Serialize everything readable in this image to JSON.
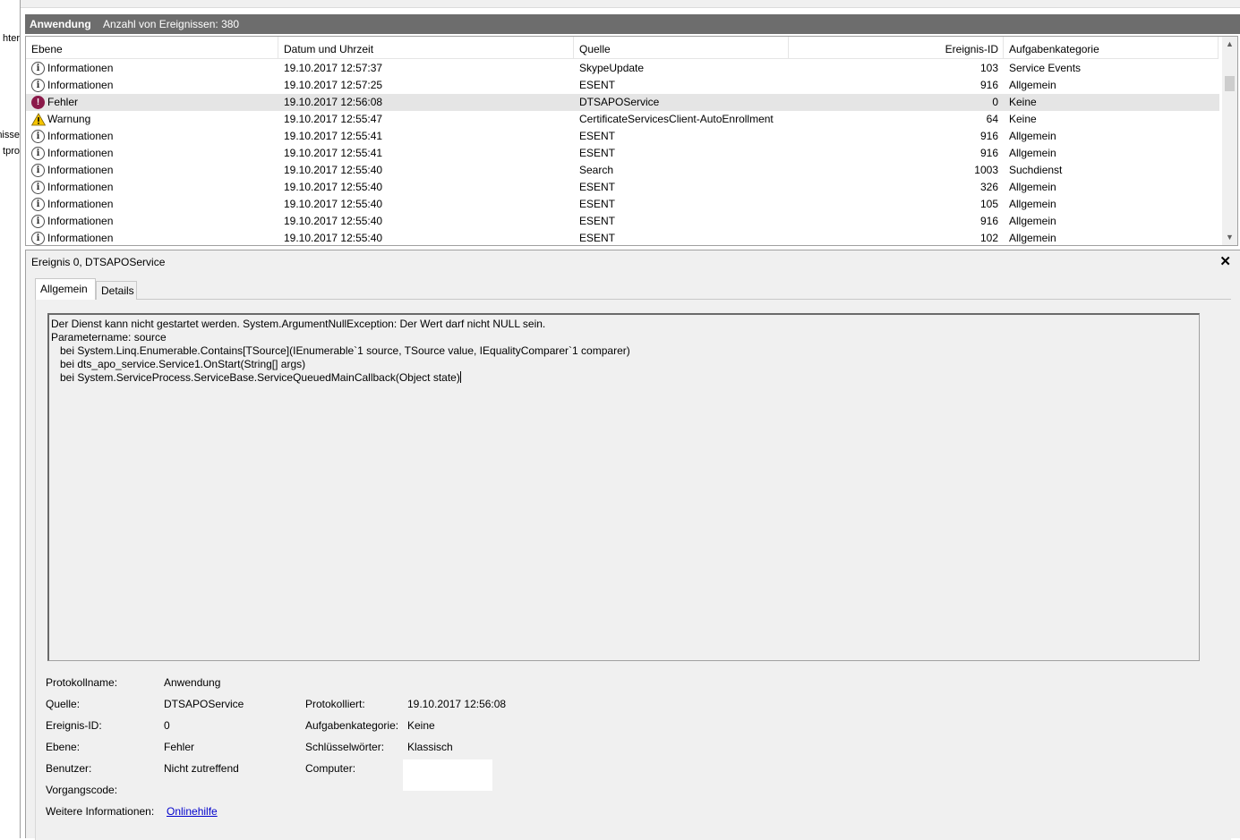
{
  "left_fragments": [
    "hter",
    "nisse",
    "tpro"
  ],
  "title_bar": {
    "log_name": "Anwendung",
    "count_text": "Anzahl von Ereignissen: 380"
  },
  "columns": {
    "level": "Ebene",
    "datetime": "Datum und Uhrzeit",
    "source": "Quelle",
    "event_id": "Ereignis-ID",
    "category": "Aufgabenkategorie"
  },
  "events": [
    {
      "level": "Informationen",
      "icon": "info-icon",
      "datetime": "19.10.2017 12:57:37",
      "source": "SkypeUpdate",
      "id": "103",
      "category": "Service Events"
    },
    {
      "level": "Informationen",
      "icon": "info-icon",
      "datetime": "19.10.2017 12:57:25",
      "source": "ESENT",
      "id": "916",
      "category": "Allgemein"
    },
    {
      "level": "Fehler",
      "icon": "error-icon",
      "datetime": "19.10.2017 12:56:08",
      "source": "DTSAPOService",
      "id": "0",
      "category": "Keine",
      "selected": true
    },
    {
      "level": "Warnung",
      "icon": "warning-icon",
      "datetime": "19.10.2017 12:55:47",
      "source": "CertificateServicesClient-AutoEnrollment",
      "id": "64",
      "category": "Keine"
    },
    {
      "level": "Informationen",
      "icon": "info-icon",
      "datetime": "19.10.2017 12:55:41",
      "source": "ESENT",
      "id": "916",
      "category": "Allgemein"
    },
    {
      "level": "Informationen",
      "icon": "info-icon",
      "datetime": "19.10.2017 12:55:41",
      "source": "ESENT",
      "id": "916",
      "category": "Allgemein"
    },
    {
      "level": "Informationen",
      "icon": "info-icon",
      "datetime": "19.10.2017 12:55:40",
      "source": "Search",
      "id": "1003",
      "category": "Suchdienst"
    },
    {
      "level": "Informationen",
      "icon": "info-icon",
      "datetime": "19.10.2017 12:55:40",
      "source": "ESENT",
      "id": "326",
      "category": "Allgemein"
    },
    {
      "level": "Informationen",
      "icon": "info-icon",
      "datetime": "19.10.2017 12:55:40",
      "source": "ESENT",
      "id": "105",
      "category": "Allgemein"
    },
    {
      "level": "Informationen",
      "icon": "info-icon",
      "datetime": "19.10.2017 12:55:40",
      "source": "ESENT",
      "id": "916",
      "category": "Allgemein"
    },
    {
      "level": "Informationen",
      "icon": "info-icon",
      "datetime": "19.10.2017 12:55:40",
      "source": "ESENT",
      "id": "102",
      "category": "Allgemein"
    }
  ],
  "detail": {
    "title": "Ereignis 0, DTSAPOService",
    "close_glyph": "✕",
    "tabs": {
      "general": "Allgemein",
      "details": "Details"
    },
    "message_lines": [
      "Der Dienst kann nicht gestartet werden. System.ArgumentNullException: Der Wert darf nicht NULL sein.",
      "Parametername: source",
      "   bei System.Linq.Enumerable.Contains[TSource](IEnumerable`1 source, TSource value, IEqualityComparer`1 comparer)",
      "   bei dts_apo_service.Service1.OnStart(String[] args)",
      "   bei System.ServiceProcess.ServiceBase.ServiceQueuedMainCallback(Object state)"
    ],
    "fields": {
      "log_name_label": "Protokollname:",
      "log_name": "Anwendung",
      "source_label": "Quelle:",
      "source": "DTSAPOService",
      "logged_label": "Protokolliert:",
      "logged": "19.10.2017 12:56:08",
      "event_id_label": "Ereignis-ID:",
      "event_id": "0",
      "task_cat_label": "Aufgabenkategorie:",
      "task_cat": "Keine",
      "level_label": "Ebene:",
      "level": "Fehler",
      "keywords_label": "Schlüsselwörter:",
      "keywords": "Klassisch",
      "user_label": "Benutzer:",
      "user": "Nicht zutreffend",
      "computer_label": "Computer:",
      "computer": "",
      "opcode_label": "Vorgangscode:",
      "opcode": "",
      "more_info_label": "Weitere Informationen:",
      "more_info_link": "Onlinehilfe"
    }
  },
  "colors": {
    "title_bar": "#6d6d6d",
    "selected_row": "#e5e5e5",
    "error_icon": "#8b1a4a",
    "warning_icon": "#f5c400",
    "link": "#0000cc"
  }
}
